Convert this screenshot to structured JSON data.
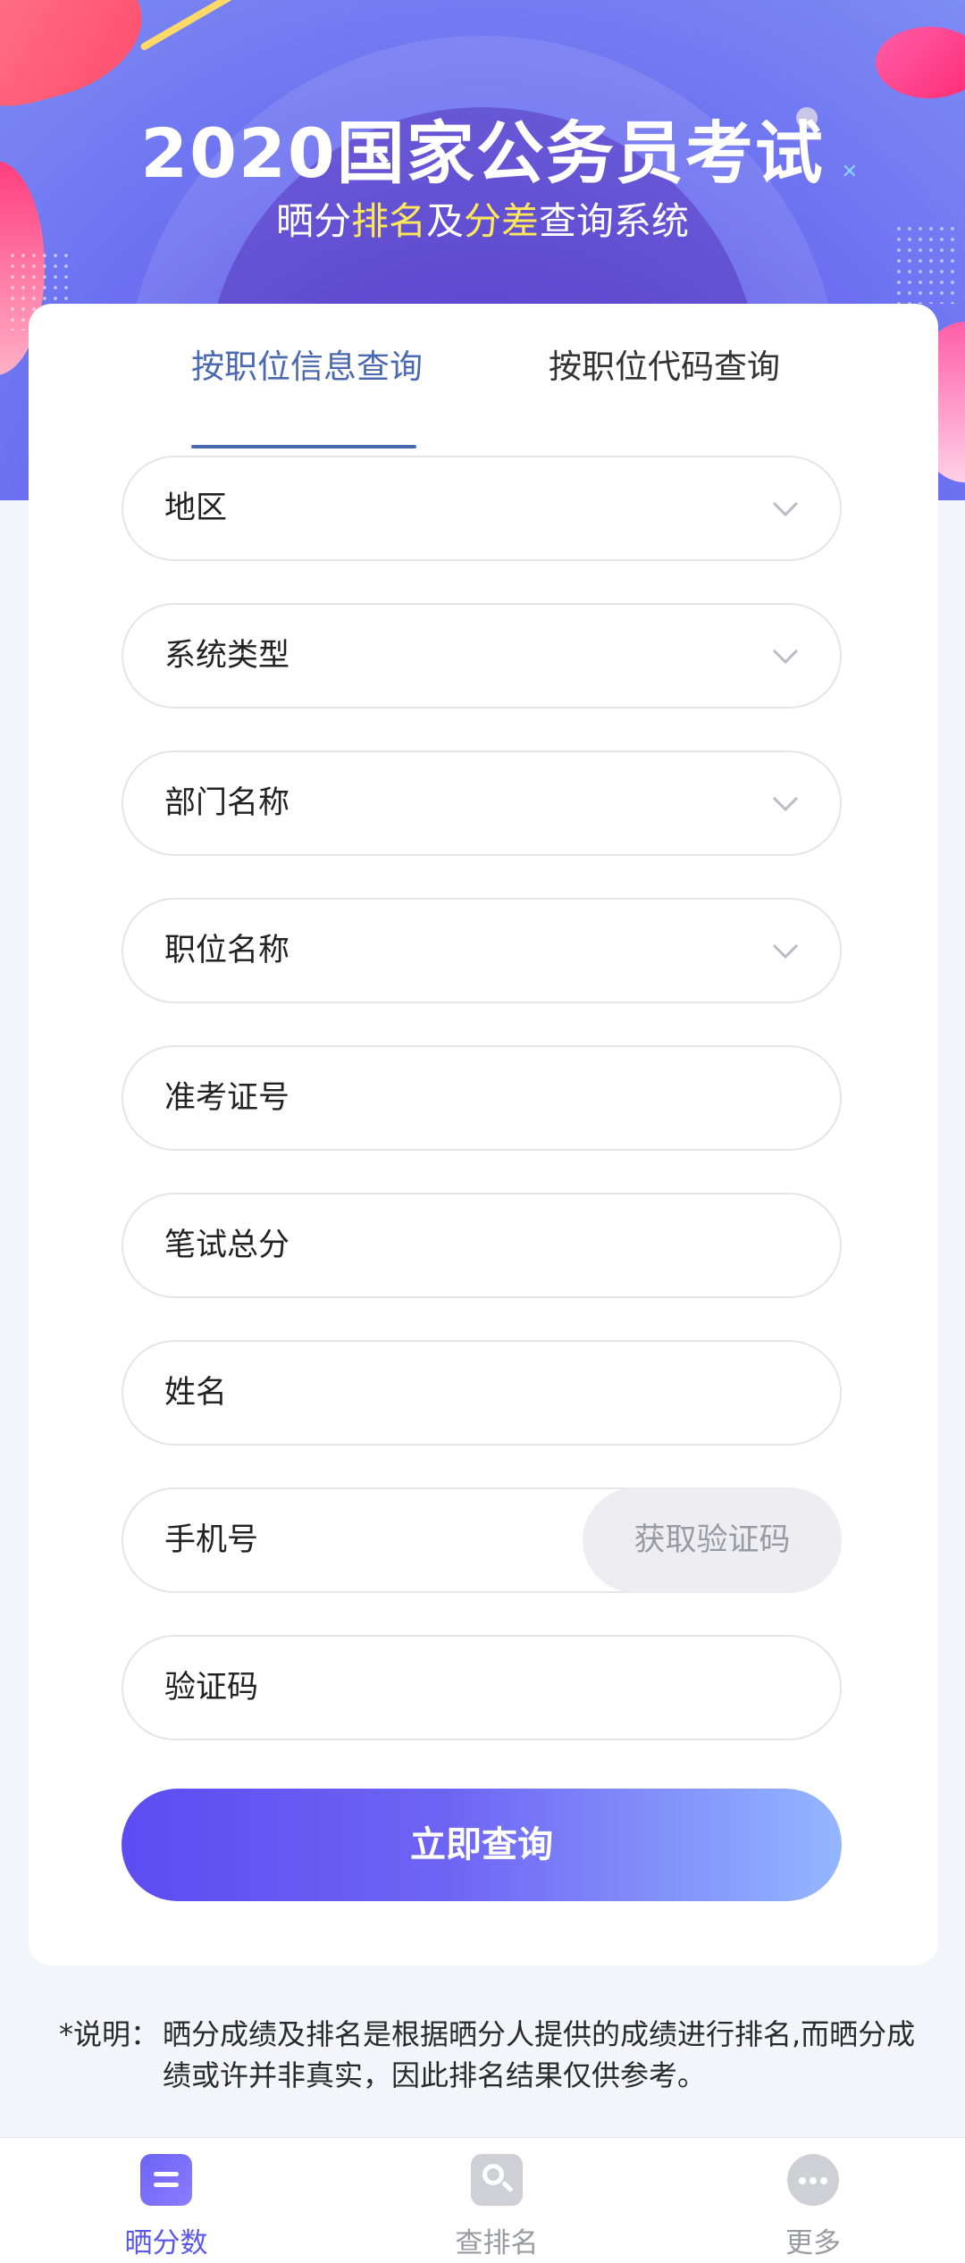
{
  "header": {
    "title": "2020国家公务员考试",
    "subtitle_parts": [
      "晒分",
      "排名",
      "及",
      "分差",
      "查询系统"
    ]
  },
  "tabs": [
    {
      "label": "按职位信息查询",
      "active": true
    },
    {
      "label": "按职位代码查询",
      "active": false
    }
  ],
  "form": {
    "region": "地区",
    "system_type": "系统类型",
    "department": "部门名称",
    "position": "职位名称",
    "exam_id": "准考证号",
    "written_score": "笔试总分",
    "name": "姓名",
    "phone": "手机号",
    "get_code": "获取验证码",
    "verification_code": "验证码",
    "submit": "立即查询"
  },
  "note": {
    "prefix": "*说明：",
    "text": "晒分成绩及排名是根据晒分人提供的成绩进行排名,而晒分成绩或许并非真实，因此排名结果仅供参考。"
  },
  "tabbar": [
    {
      "label": "晒分数",
      "icon": "list-icon",
      "active": true
    },
    {
      "label": "查排名",
      "icon": "search-icon",
      "active": false
    },
    {
      "label": "更多",
      "icon": "more-icon",
      "active": false
    }
  ],
  "colors": {
    "accent": "#5b57e8",
    "tab_active": "#4b69b0",
    "highlight": "#ffe75a"
  }
}
